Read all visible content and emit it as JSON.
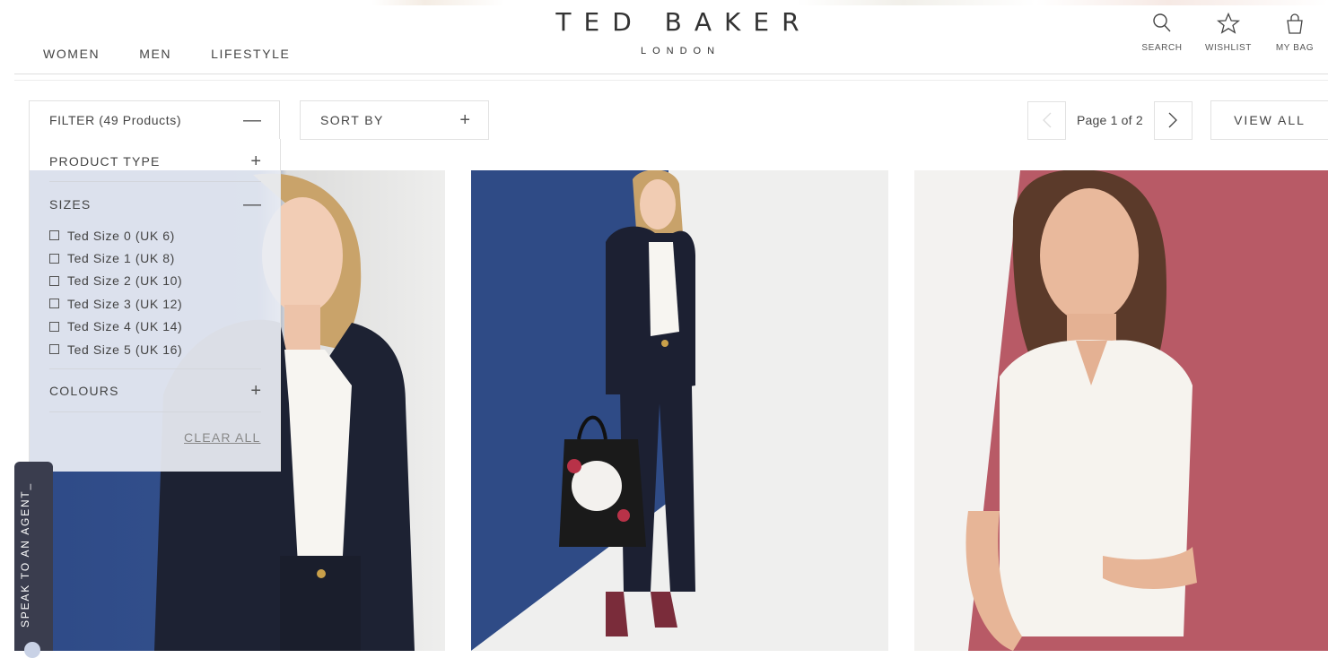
{
  "header": {
    "nav": [
      "WOMEN",
      "MEN",
      "LIFESTYLE"
    ],
    "logo_main": "TED BAKER",
    "logo_sub": "LONDON",
    "icons": [
      {
        "name": "search-icon",
        "label": "SEARCH"
      },
      {
        "name": "star-icon",
        "label": "WISHLIST"
      },
      {
        "name": "bag-icon",
        "label": "MY BAG"
      }
    ]
  },
  "toolbar": {
    "filter_label": "FILTER (49 Products)",
    "sort_label": "SORT BY",
    "page_text": "Page 1 of 2",
    "view_all": "VIEW ALL"
  },
  "filter_panel": {
    "product_type": "PRODUCT TYPE",
    "sizes": "SIZES",
    "size_options": [
      "Ted Size 0 (UK 6)",
      "Ted Size 1 (UK 8)",
      "Ted Size 2 (UK 10)",
      "Ted Size 3 (UK 12)",
      "Ted Size 4 (UK 14)",
      "Ted Size 5 (UK 16)"
    ],
    "colours": "COLOURS",
    "clear_all": "CLEAR ALL"
  },
  "chat": {
    "label": "SPEAK TO AN AGENT_"
  },
  "colors": {
    "navy_blue": "#2f4b86",
    "rose": "#b85a66",
    "chat_tab": "#3a3d4e"
  }
}
